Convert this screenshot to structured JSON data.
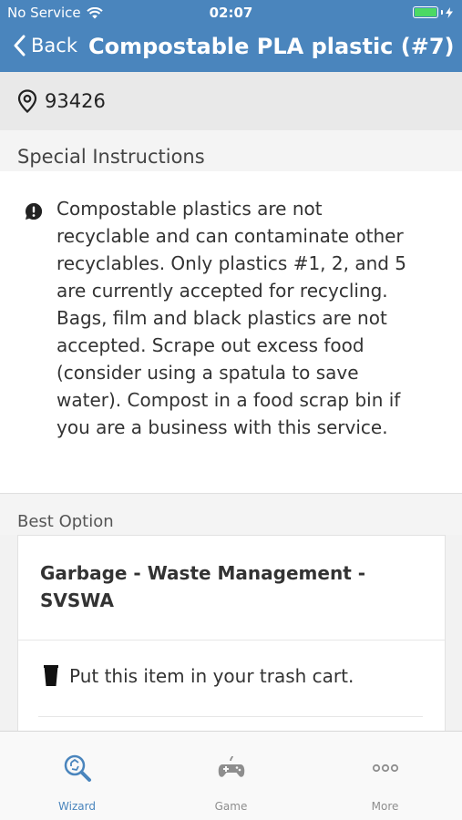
{
  "status_bar": {
    "carrier": "No Service",
    "time": "02:07"
  },
  "nav": {
    "back_label": "Back",
    "title": "Compostable PLA plastic (#7)"
  },
  "location": {
    "zip": "93426"
  },
  "special_instructions": {
    "header": "Special Instructions",
    "text": "Compostable plastics are not recyclable and can contaminate other recyclables. Only plastics #1, 2, and 5 are currently accepted for recycling. Bags, film and black plastics are not accepted. Scrape out excess food (consider using a spatula to save water). Compost in a food scrap bin if you are a business with this service."
  },
  "best_option": {
    "header": "Best Option",
    "title": "Garbage - Waste Management - SVSWA",
    "action": "Put this item in your trash cart."
  },
  "tabs": [
    {
      "label": "Wizard",
      "icon": "recycle-search-icon",
      "active": true
    },
    {
      "label": "Game",
      "icon": "gamepad-icon",
      "active": false
    },
    {
      "label": "More",
      "icon": "more-dots-icon",
      "active": false
    }
  ],
  "colors": {
    "brand": "#4a85bd",
    "battery": "#4cd964"
  }
}
